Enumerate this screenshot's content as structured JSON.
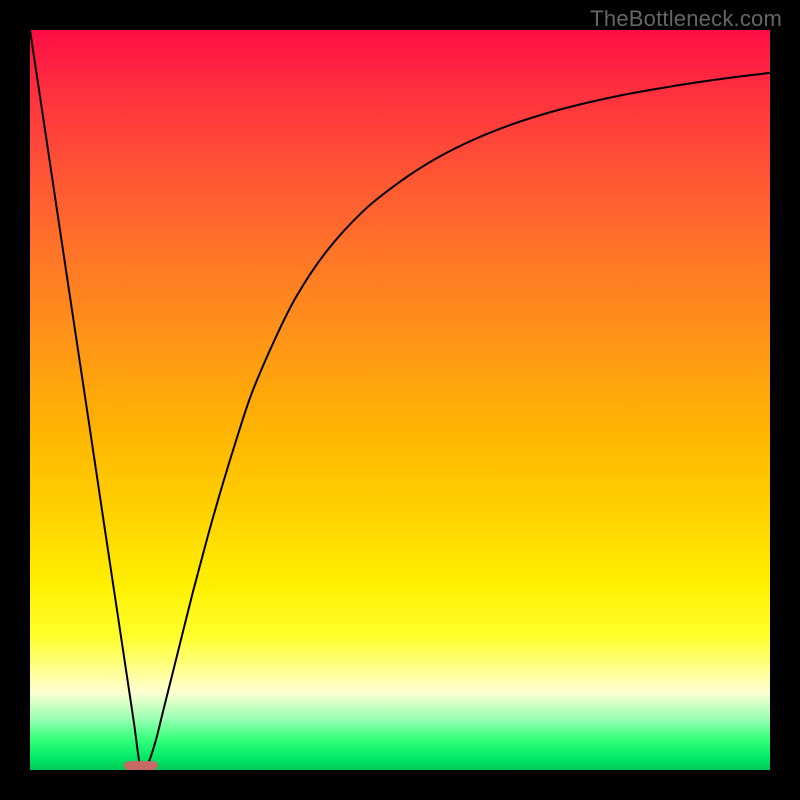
{
  "watermark": "TheBottleneck.com",
  "chart_data": {
    "type": "line",
    "title": "",
    "xlabel": "",
    "ylabel": "",
    "xlim": [
      0,
      100
    ],
    "ylim": [
      0,
      100
    ],
    "x": [
      0,
      2,
      4,
      6,
      8,
      10,
      12,
      14,
      15,
      16,
      17,
      18,
      20,
      22,
      24,
      26,
      28,
      30,
      33,
      36,
      40,
      45,
      50,
      55,
      60,
      65,
      70,
      75,
      80,
      85,
      90,
      95,
      100
    ],
    "values": [
      100,
      86.7,
      73.3,
      60.0,
      46.7,
      33.3,
      20.0,
      6.7,
      0,
      1.0,
      4.0,
      8.0,
      16.0,
      24.0,
      31.5,
      38.5,
      45.0,
      51.0,
      58.0,
      64.0,
      70.0,
      75.5,
      79.5,
      82.7,
      85.2,
      87.2,
      88.8,
      90.1,
      91.2,
      92.1,
      92.9,
      93.6,
      94.2
    ],
    "marker": {
      "x_center": 15,
      "x_halfwidth": 2.3,
      "y": 0,
      "height_pct": 1.2
    },
    "colors": {
      "curve": "#000000",
      "marker": "#c76a67",
      "frame": "#000000"
    }
  }
}
